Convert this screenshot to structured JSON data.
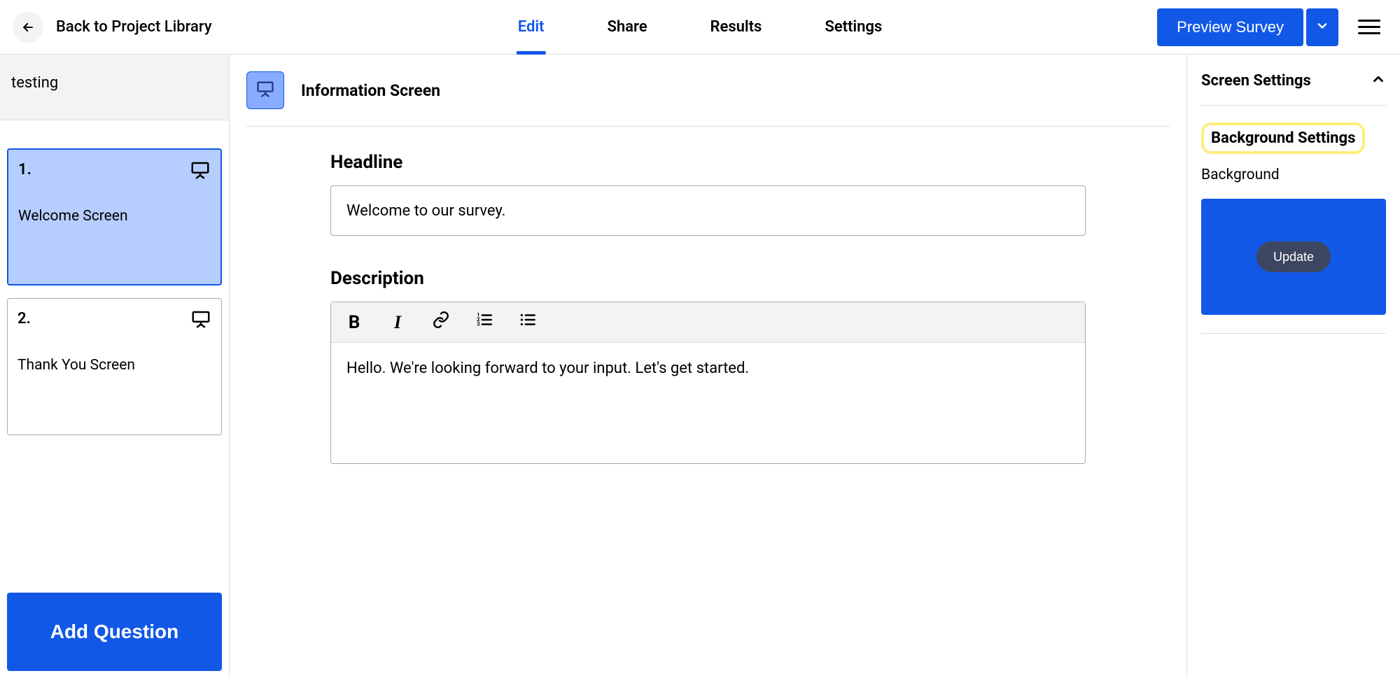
{
  "header": {
    "back_label": "Back to Project Library",
    "tabs": [
      "Edit",
      "Share",
      "Results",
      "Settings"
    ],
    "active_tab_index": 0,
    "preview_label": "Preview Survey"
  },
  "left": {
    "project_name": "testing",
    "screens": [
      {
        "num": "1.",
        "title": "Welcome Screen",
        "selected": true
      },
      {
        "num": "2.",
        "title": "Thank You Screen",
        "selected": false
      }
    ],
    "add_question_label": "Add Question"
  },
  "editor": {
    "type_label": "Information Screen",
    "headline_label": "Headline",
    "headline_value": "Welcome to our survey.",
    "description_label": "Description",
    "description_value": "Hello. We're looking forward to your input. Let's get started."
  },
  "right": {
    "settings_title": "Screen Settings",
    "bg_settings_label": "Background Settings",
    "bg_label": "Background",
    "update_label": "Update",
    "bg_color": "#1258e6"
  }
}
